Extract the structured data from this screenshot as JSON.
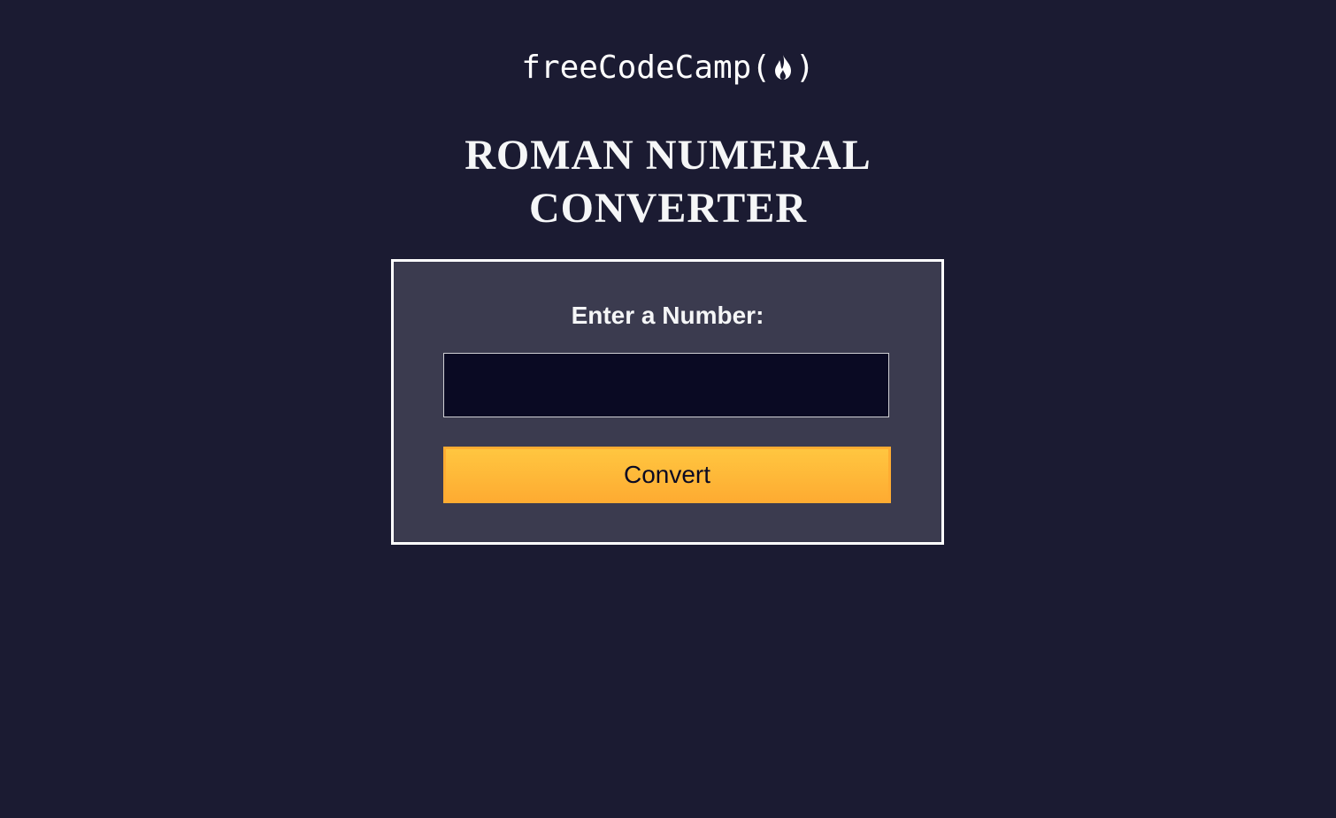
{
  "logo": {
    "text_before": "freeCodeCamp(",
    "icon": "fire-icon",
    "text_after": ")"
  },
  "title": {
    "line1": "ROMAN NUMERAL",
    "line2": "CONVERTER"
  },
  "form": {
    "label": "Enter a Number:",
    "input_value": "",
    "button_label": "Convert"
  },
  "colors": {
    "background": "#1b1b32",
    "card": "#3b3b4f",
    "input": "#0a0a23",
    "button": "#feac32"
  }
}
